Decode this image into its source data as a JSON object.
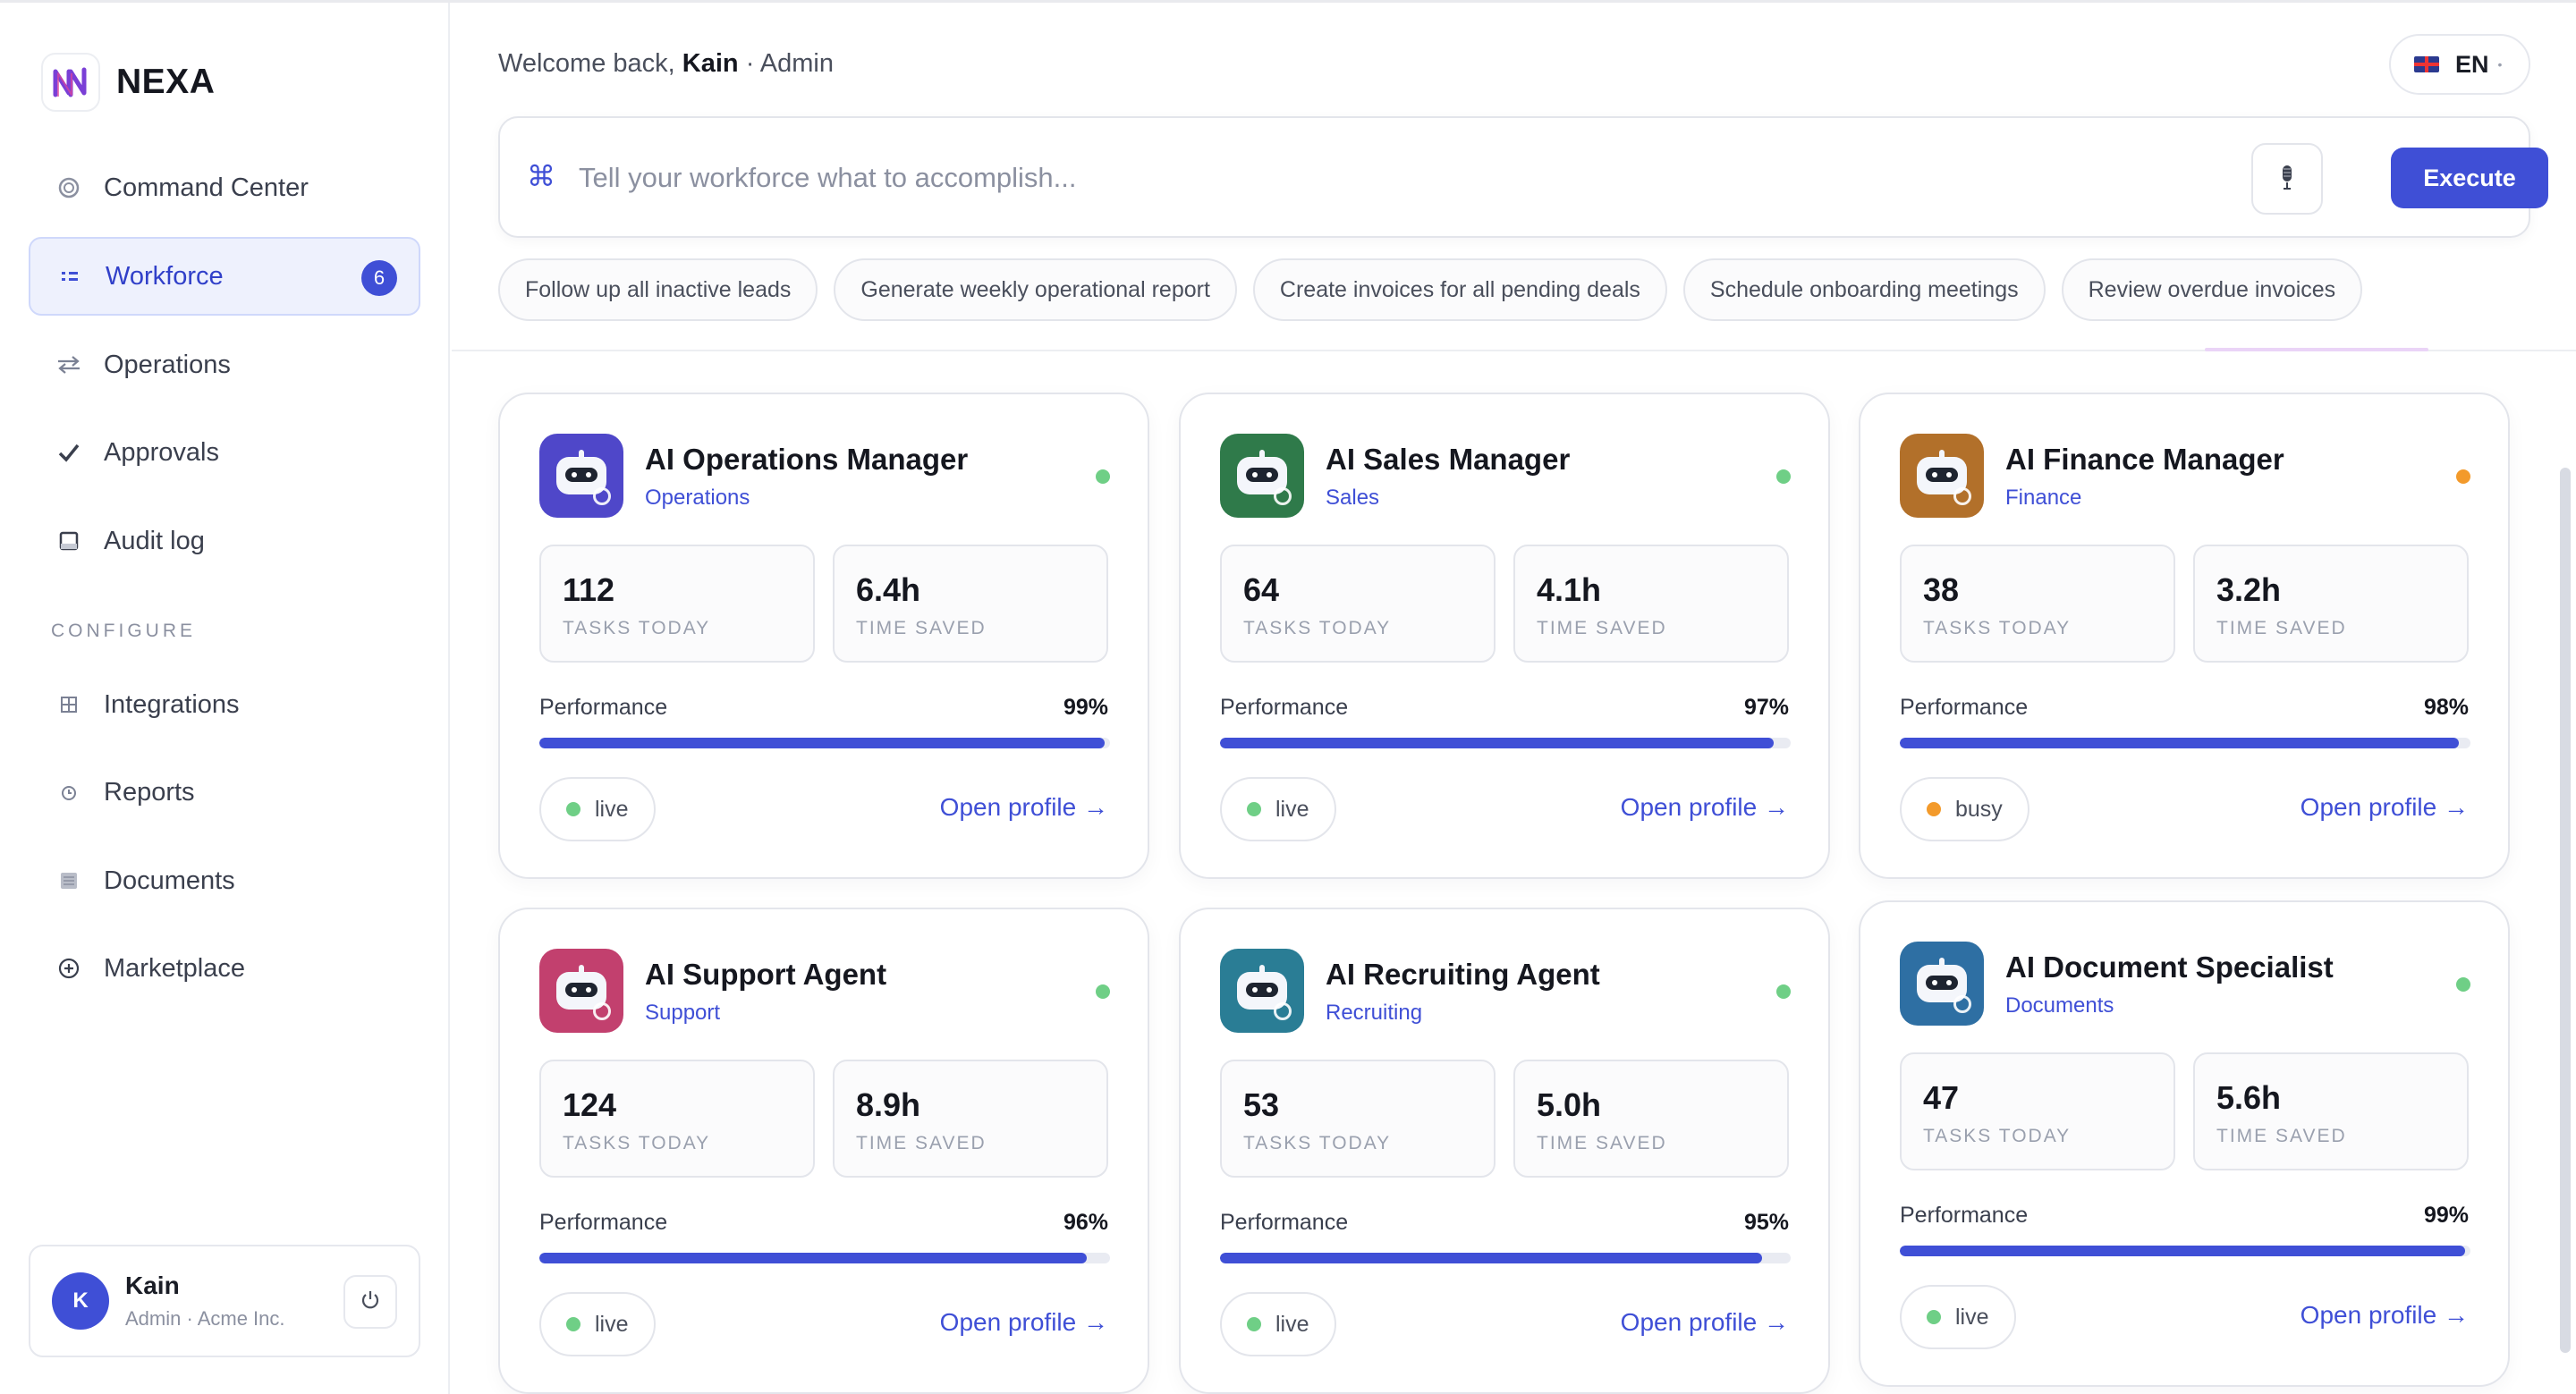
{
  "brand": {
    "name": "NEXA"
  },
  "sidebar": {
    "items": [
      {
        "label": "Command Center",
        "icon": "circle-icon"
      },
      {
        "label": "Workforce",
        "icon": "grid-dots-icon",
        "badge": "6",
        "active": true
      },
      {
        "label": "Operations",
        "icon": "swap-icon"
      },
      {
        "label": "Approvals",
        "icon": "check-icon"
      },
      {
        "label": "Audit log",
        "icon": "square-icon"
      }
    ],
    "configure_label": "CONFIGURE",
    "configure_items": [
      {
        "label": "Integrations",
        "icon": "grid-icon"
      },
      {
        "label": "Reports",
        "icon": "clock-icon"
      },
      {
        "label": "Documents",
        "icon": "document-icon"
      },
      {
        "label": "Marketplace",
        "icon": "plus-circle-icon"
      }
    ]
  },
  "user": {
    "initial": "K",
    "name": "Kain",
    "role": "Admin · Acme Inc."
  },
  "header": {
    "welcome_prefix": "Welcome back,",
    "welcome_name": "Kain",
    "welcome_suffix": "· Admin",
    "language": "EN"
  },
  "command": {
    "placeholder": "Tell your workforce what to accomplish...",
    "icon": "command-icon",
    "execute_label": "Execute"
  },
  "suggestions": [
    "Follow up all inactive leads",
    "Generate weekly operational report",
    "Create invoices for all pending deals",
    "Schedule onboarding meetings",
    "Review overdue invoices"
  ],
  "agents": [
    {
      "name": "AI Operations Manager",
      "dept": "Operations",
      "tasks": "112",
      "tasks_label": "TASKS TODAY",
      "saved": "6.4h",
      "saved_label": "TIME SAVED",
      "perf_label": "Performance",
      "perf": "99%",
      "perf_value": 0.99,
      "status": "live",
      "open": "Open profile →",
      "icon_color": "#4f47c9",
      "dot_color": "#6fcf86"
    },
    {
      "name": "AI Sales Manager",
      "dept": "Sales",
      "tasks": "64",
      "tasks_label": "TASKS TODAY",
      "saved": "4.1h",
      "saved_label": "TIME SAVED",
      "perf_label": "Performance",
      "perf": "97%",
      "perf_value": 0.97,
      "status": "live",
      "open": "Open profile →",
      "icon_color": "#2f7a4a",
      "dot_color": "#6fcf86"
    },
    {
      "name": "AI Finance Manager",
      "dept": "Finance",
      "tasks": "38",
      "tasks_label": "TASKS TODAY",
      "saved": "3.2h",
      "saved_label": "TIME SAVED",
      "perf_label": "Performance",
      "perf": "98%",
      "perf_value": 0.98,
      "status": "busy",
      "open": "Open profile →",
      "icon_color": "#b2702a",
      "dot_color": "#f39a2b"
    },
    {
      "name": "AI Support Agent",
      "dept": "Support",
      "tasks": "124",
      "tasks_label": "TASKS TODAY",
      "saved": "8.9h",
      "saved_label": "TIME SAVED",
      "perf_label": "Performance",
      "perf": "96%",
      "perf_value": 0.96,
      "status": "live",
      "open": "Open profile →",
      "icon_color": "#c2406e",
      "dot_color": "#6fcf86"
    },
    {
      "name": "AI Recruiting Agent",
      "dept": "Recruiting",
      "tasks": "53",
      "tasks_label": "TASKS TODAY",
      "saved": "5.0h",
      "saved_label": "TIME SAVED",
      "perf_label": "Performance",
      "perf": "95%",
      "perf_value": 0.95,
      "status": "live",
      "open": "Open profile →",
      "icon_color": "#2a7d95",
      "dot_color": "#6fcf86"
    },
    {
      "name": "AI Document Specialist",
      "dept": "Documents",
      "tasks": "47",
      "tasks_label": "TASKS TODAY",
      "saved": "5.6h",
      "saved_label": "TIME SAVED",
      "perf_label": "Performance",
      "perf": "99%",
      "perf_value": 0.99,
      "status": "live",
      "open": "Open profile →",
      "icon_color": "#2e6fa3",
      "dot_color": "#6fcf86"
    }
  ]
}
